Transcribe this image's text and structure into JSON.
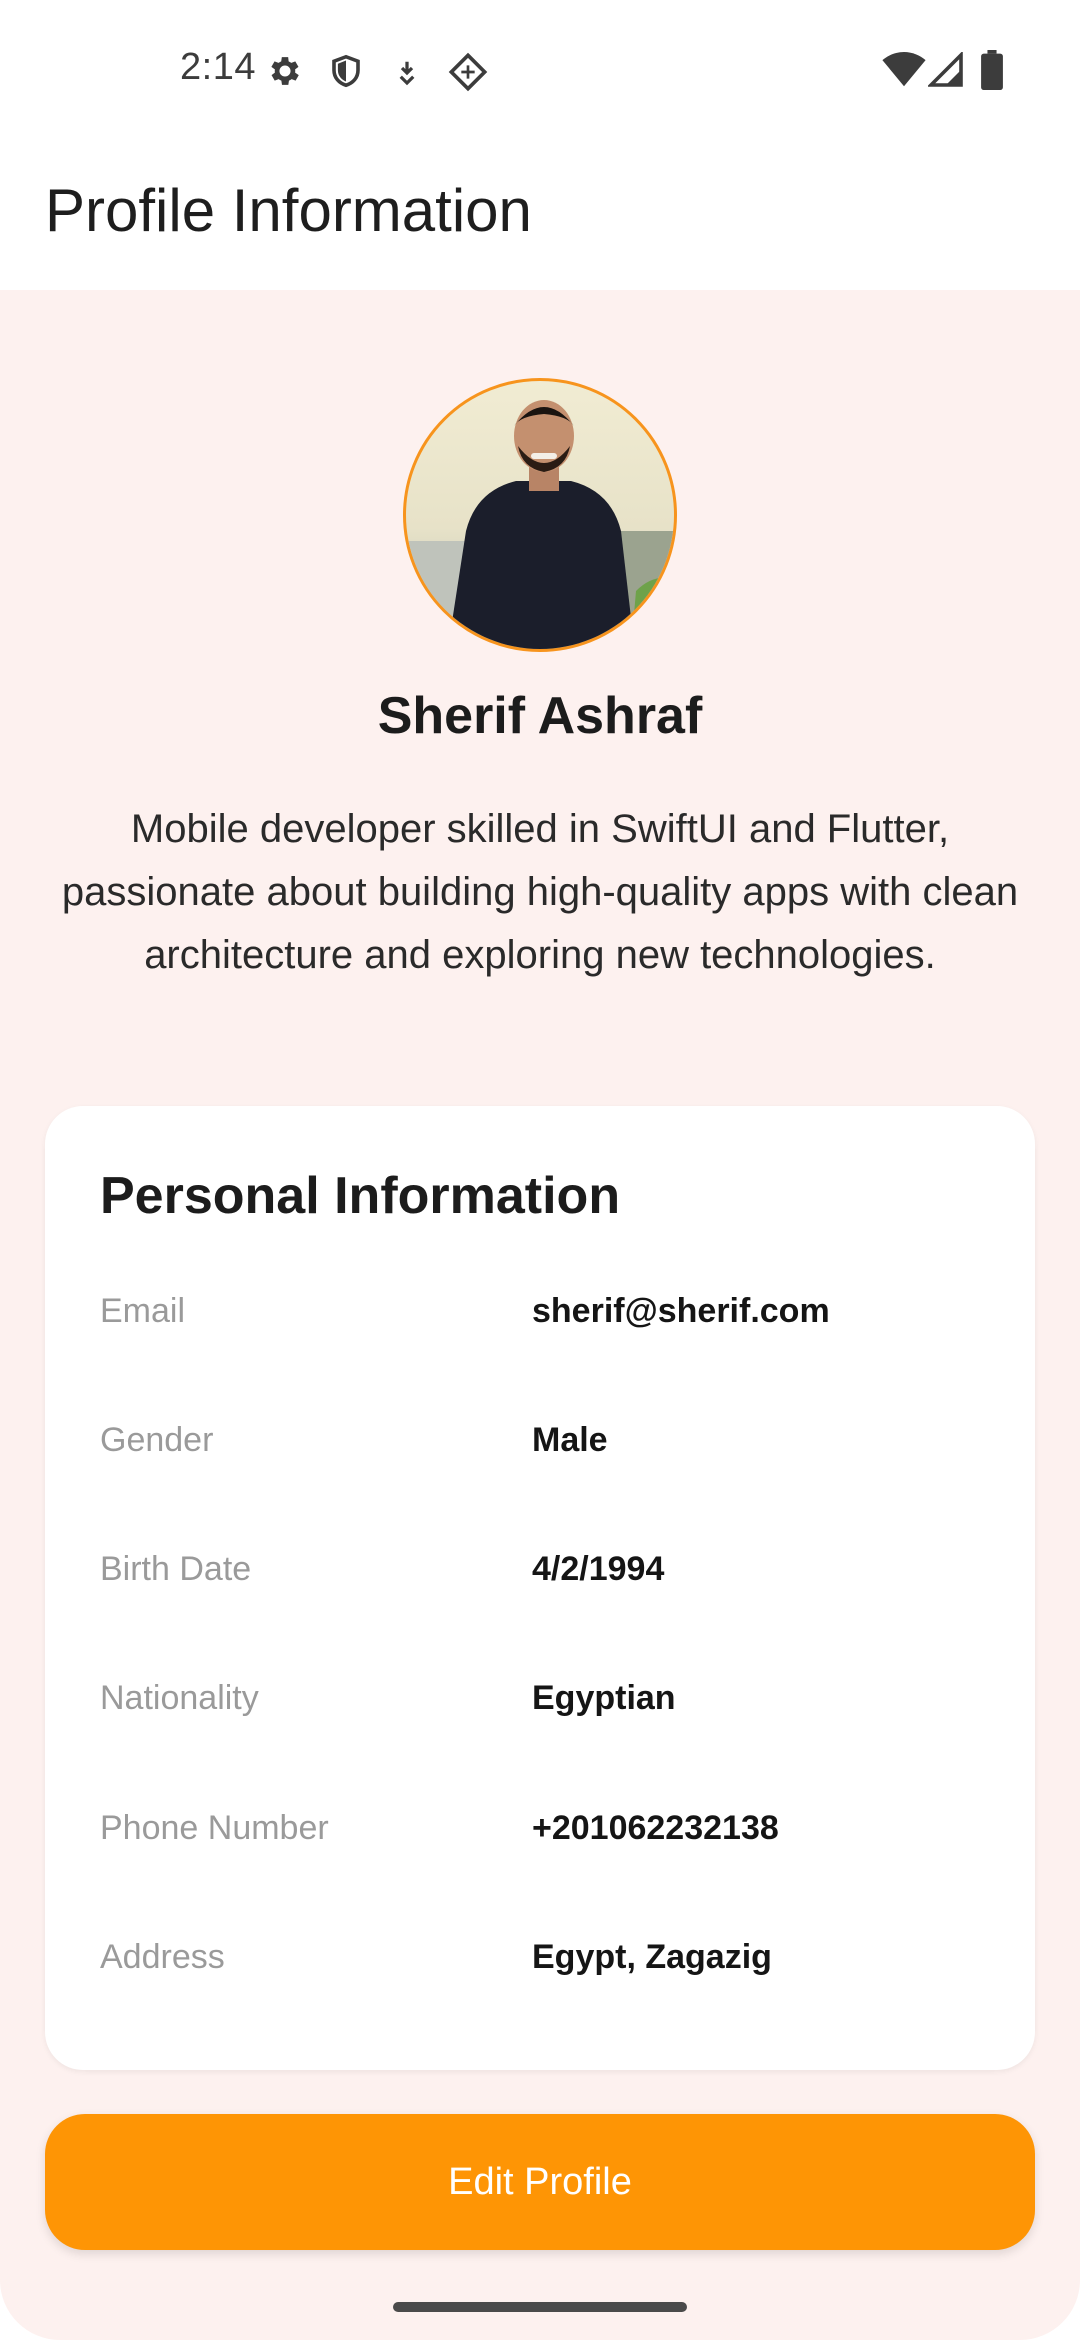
{
  "status_bar": {
    "time": "2:14",
    "icons_left": [
      "gear-icon",
      "shield-icon",
      "download-icon",
      "diamond-icon"
    ],
    "icons_right": [
      "wifi-icon",
      "signal-icon",
      "battery-icon"
    ]
  },
  "app_bar": {
    "title": "Profile Information"
  },
  "profile": {
    "name": "Sherif Ashraf",
    "bio": "Mobile developer skilled in SwiftUI and Flutter, passionate about building high-quality apps with clean architecture and exploring new technologies.",
    "avatar_border_color": "#f7941d"
  },
  "personal_info": {
    "title": "Personal Information",
    "rows": [
      {
        "label": "Email",
        "value": "sherif@sherif.com"
      },
      {
        "label": "Gender",
        "value": "Male"
      },
      {
        "label": "Birth Date",
        "value": "4/2/1994"
      },
      {
        "label": "Nationality",
        "value": "Egyptian"
      },
      {
        "label": "Phone Number",
        "value": "+201062232138"
      },
      {
        "label": "Address",
        "value": "Egypt, Zagazig"
      }
    ]
  },
  "actions": {
    "edit_label": "Edit Profile"
  },
  "colors": {
    "accent": "#fe9505",
    "background": "#fdf1ef",
    "card": "#ffffff"
  }
}
